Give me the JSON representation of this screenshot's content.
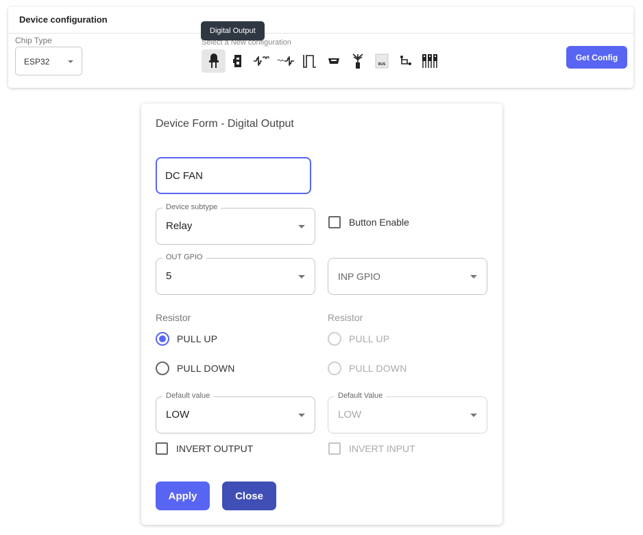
{
  "config": {
    "title": "Device configuration",
    "chip_type_label": "Chip Type",
    "chip_type_value": "ESP32",
    "new_config_label": "Select a New configuration",
    "tooltip": "Digital Output",
    "get_config_label": "Get Config",
    "icons": [
      {
        "name": "digital-output-icon",
        "active": true
      },
      {
        "name": "digital-input-icon",
        "active": false
      },
      {
        "name": "pwm-output-icon",
        "active": false
      },
      {
        "name": "analog-input-icon",
        "active": false
      },
      {
        "name": "pulse-icon",
        "active": false
      },
      {
        "name": "serial-module-icon",
        "active": false
      },
      {
        "name": "antenna-icon",
        "active": false
      },
      {
        "name": "bus-icon",
        "active": false
      },
      {
        "name": "connection-icon",
        "active": false
      },
      {
        "name": "multi-sensor-icon",
        "active": false
      }
    ],
    "bus_icon_text": "BUS"
  },
  "form": {
    "title": "Device Form - Digital Output",
    "name_value": "DC FAN",
    "subtype_legend": "Device subtype",
    "subtype_value": "Relay",
    "button_enable_label": "Button Enable",
    "out_gpio_legend": "OUT GPIO",
    "out_gpio_value": "5",
    "inp_gpio_placeholder": "INP GPIO",
    "resistor_label_left": "Resistor",
    "resistor_label_right": "Resistor",
    "pull_up_label": "PULL UP",
    "pull_down_label": "PULL DOWN",
    "default_value_legend_left": "Default value",
    "default_value_left": "LOW",
    "default_value_legend_right": "Default Value",
    "default_value_right": "LOW",
    "invert_output_label": "INVERT OUTPUT",
    "invert_input_label": "INVERT INPUT",
    "apply_label": "Apply",
    "close_label": "Close"
  },
  "colors": {
    "accent": "#5865f2",
    "close_button": "#3f4fb5",
    "tooltip_bg": "#2f3743"
  }
}
